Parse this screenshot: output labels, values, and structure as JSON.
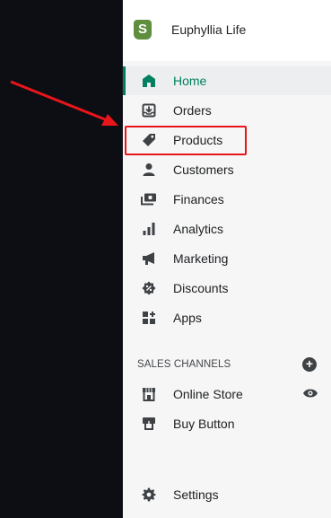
{
  "store": {
    "name": "Euphyllia Life",
    "logo_letter": "S"
  },
  "nav": {
    "items": [
      {
        "label": "Home",
        "icon": "home-icon"
      },
      {
        "label": "Orders",
        "icon": "orders-icon"
      },
      {
        "label": "Products",
        "icon": "tag-icon"
      },
      {
        "label": "Customers",
        "icon": "customer-icon"
      },
      {
        "label": "Finances",
        "icon": "finances-icon"
      },
      {
        "label": "Analytics",
        "icon": "bar-chart-icon"
      },
      {
        "label": "Marketing",
        "icon": "megaphone-icon"
      },
      {
        "label": "Discounts",
        "icon": "discount-icon"
      },
      {
        "label": "Apps",
        "icon": "apps-icon"
      }
    ],
    "active": "Home"
  },
  "sales_channels": {
    "title": "SALES CHANNELS",
    "items": [
      {
        "label": "Online Store",
        "icon": "store-icon"
      },
      {
        "label": "Buy Button",
        "icon": "buy-button-icon"
      }
    ]
  },
  "settings": {
    "label": "Settings",
    "icon": "gear-icon"
  },
  "annotation": {
    "arrow_color": "#e8151b",
    "highlight_target": "Products"
  },
  "colors": {
    "accent": "#008060",
    "icon": "#3e4245",
    "sidebar_bg": "#f6f6f7"
  }
}
